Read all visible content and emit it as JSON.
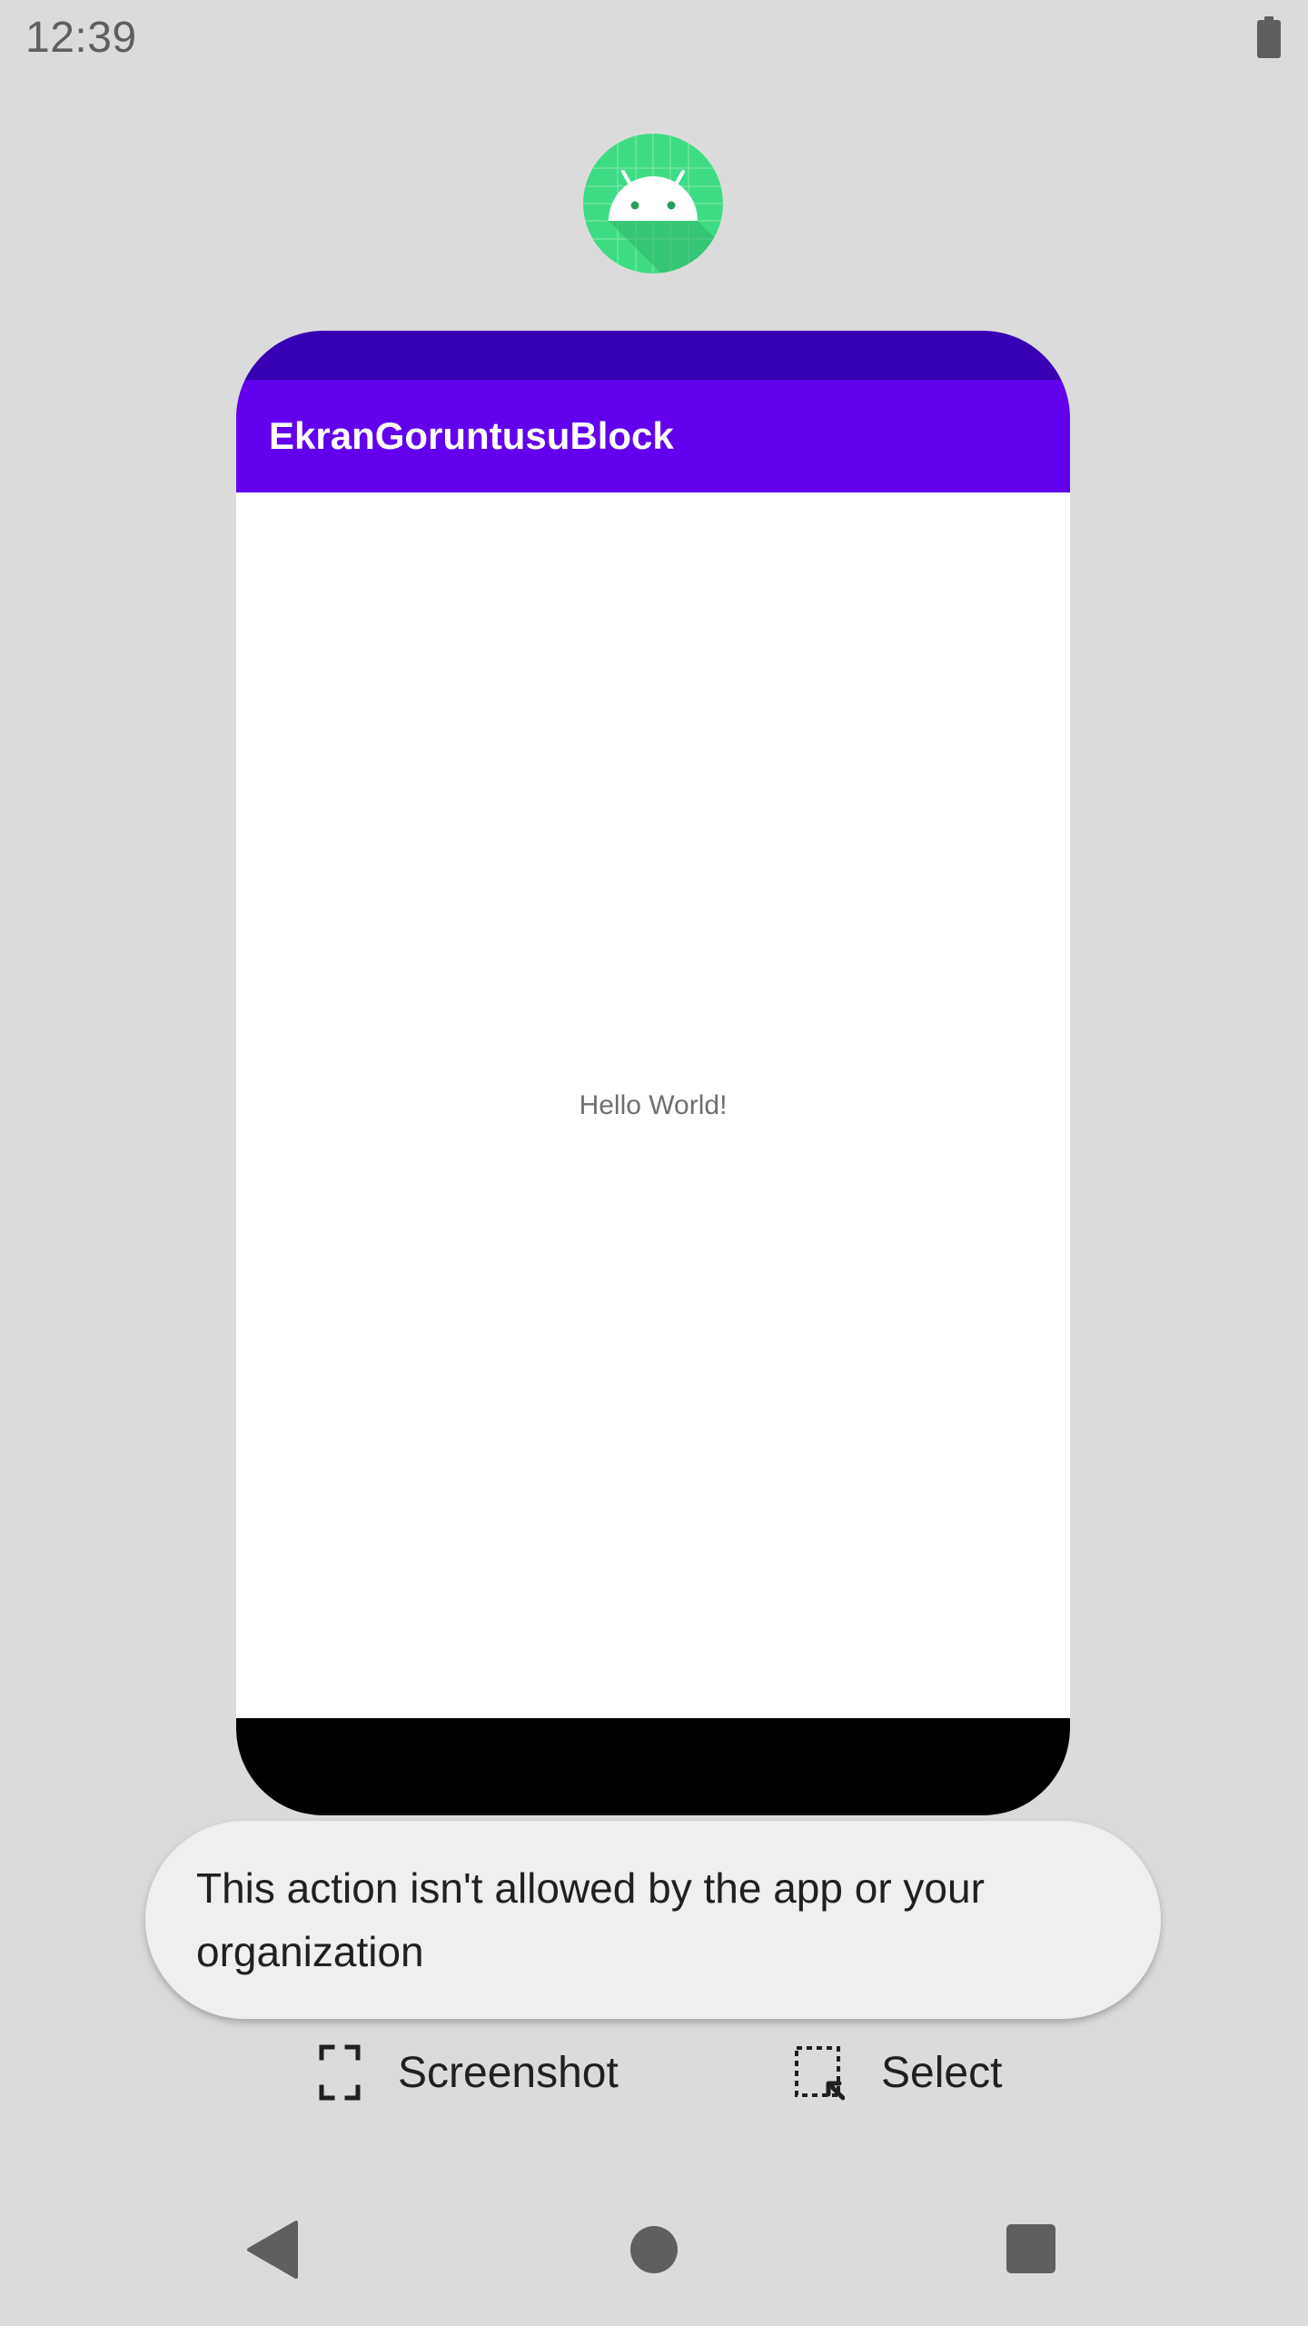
{
  "status_bar": {
    "time": "12:39",
    "battery_icon": "battery-full-icon"
  },
  "recents": {
    "app_icon": "android-app-icon",
    "app": {
      "title": "EkranGoruntusuBlock",
      "content_text": "Hello World!"
    }
  },
  "toast": {
    "message": "This action isn't allowed by the app or your organization"
  },
  "actions": {
    "screenshot": {
      "label": "Screenshot",
      "icon": "screenshot-icon"
    },
    "select": {
      "label": "Select",
      "icon": "select-icon"
    }
  },
  "navigation": {
    "back_icon": "back-icon",
    "home_icon": "home-icon",
    "recents_icon": "recents-icon"
  },
  "colors": {
    "background": "#dcdbdc",
    "app_status_bar": "#3700b3",
    "app_toolbar": "#6200ee",
    "icon_green": "#3ddc84"
  }
}
